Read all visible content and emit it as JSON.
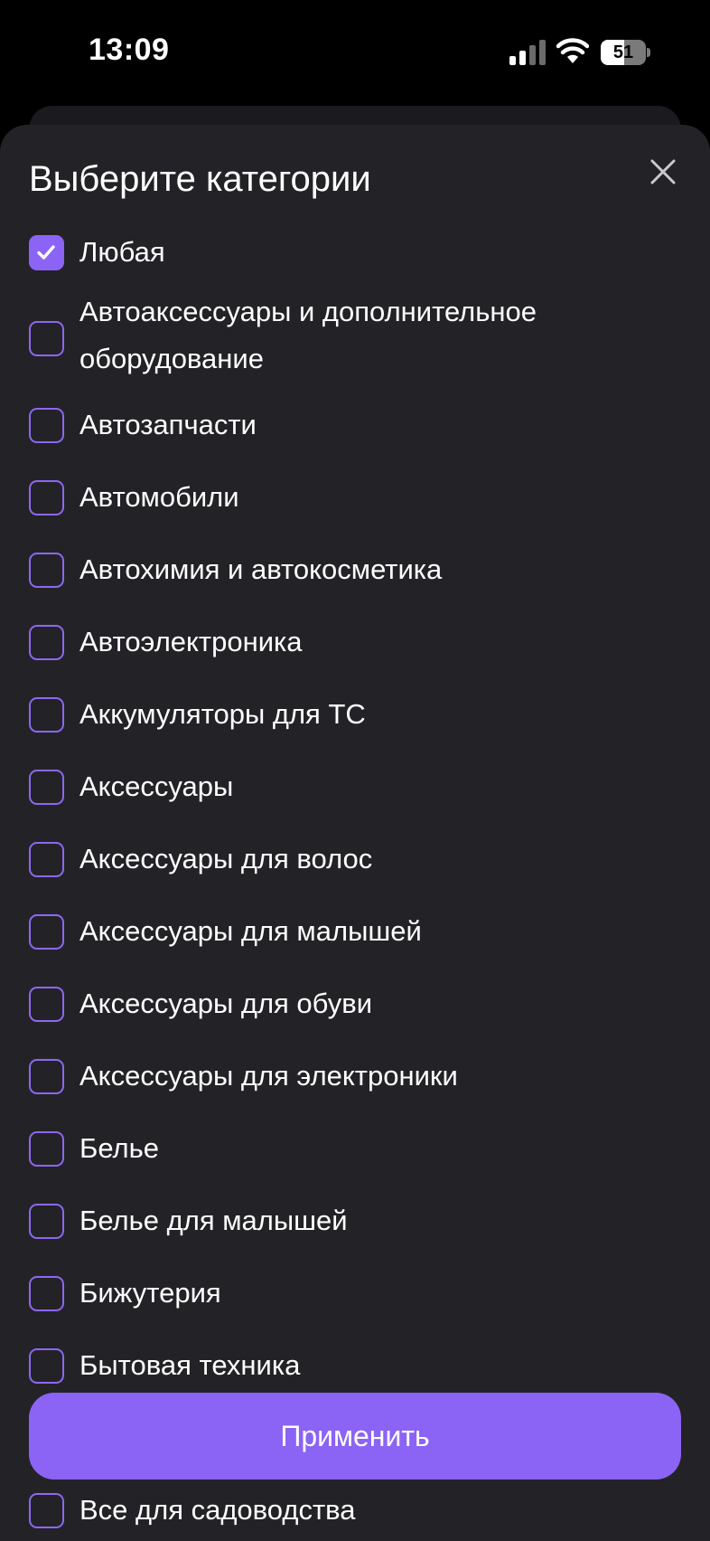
{
  "status_bar": {
    "time": "13:09",
    "battery": "51",
    "battery_level": 0.51
  },
  "sheet": {
    "title": "Выберите категории",
    "apply_label": "Применить"
  },
  "categories": [
    {
      "label": "Любая",
      "checked": true
    },
    {
      "label": "Автоаксессуары и дополнительное",
      "label_line2": "оборудование",
      "checked": false
    },
    {
      "label": "Автозапчасти",
      "checked": false
    },
    {
      "label": "Автомобили",
      "checked": false
    },
    {
      "label": "Автохимия и автокосметика",
      "checked": false
    },
    {
      "label": "Автоэлектроника",
      "checked": false
    },
    {
      "label": "Аккумуляторы для ТС",
      "checked": false
    },
    {
      "label": "Аксессуары",
      "checked": false
    },
    {
      "label": "Аксессуары для волос",
      "checked": false
    },
    {
      "label": "Аксессуары для малышей",
      "checked": false
    },
    {
      "label": "Аксессуары для обуви",
      "checked": false
    },
    {
      "label": "Аксессуары для электроники",
      "checked": false
    },
    {
      "label": "Белье",
      "checked": false
    },
    {
      "label": "Белье для малышей",
      "checked": false
    },
    {
      "label": "Бижутерия",
      "checked": false
    },
    {
      "label": "Бытовая техника",
      "checked": false
    },
    {
      "label": "",
      "checked": false
    },
    {
      "label": "Все для садоводства",
      "checked": false
    }
  ],
  "colors": {
    "accent": "#8b63f5",
    "sheet_bg": "#232327",
    "page_bg": "#000000"
  },
  "icons": {
    "close": "close-icon",
    "check": "check-icon",
    "signal": "cellular-signal-icon",
    "wifi": "wifi-icon",
    "battery": "battery-icon"
  }
}
